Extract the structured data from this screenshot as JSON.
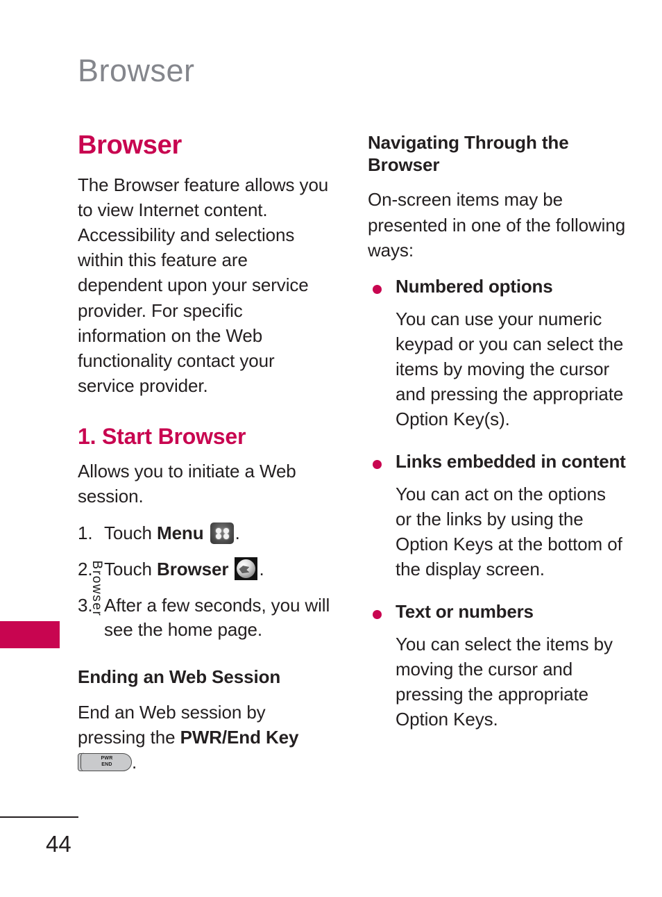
{
  "page": {
    "running_header": "Browser",
    "side_tab_label": "Browser",
    "page_number": "44",
    "accent_color": "#c80550",
    "header_color": "#84868c",
    "text_color": "#231f20"
  },
  "left_column": {
    "heading": "Browser",
    "intro": "The Browser feature allows you to view Internet content. Accessibility and selections within this feature are dependent upon your service provider. For specific information on the Web functionality contact your service provider.",
    "section_heading": "1. Start Browser",
    "section_intro": "Allows you to initiate a Web session.",
    "steps": [
      {
        "num": "1.",
        "pre": "Touch ",
        "bold": "Menu",
        "icon": "menu-grid-icon",
        "post": "."
      },
      {
        "num": "2.",
        "pre": "Touch ",
        "bold": "Browser",
        "icon": "globe-browser-icon",
        "post": "."
      },
      {
        "num": "3.",
        "pre": "After a few seconds, you will see the home page.",
        "bold": "",
        "icon": "",
        "post": ""
      }
    ],
    "subsection_heading": "Ending an Web Session",
    "ending_pre": "End an Web session by pressing the ",
    "ending_bold": "PWR/End Key",
    "ending_icon": "pwr-end-key-icon",
    "ending_icon_line1": "PWR",
    "ending_icon_line2": "END",
    "ending_post": "."
  },
  "right_column": {
    "heading": "Navigating Through the Browser",
    "intro": "On-screen items may be presented in one of the following ways:",
    "bullets": [
      {
        "title": "Numbered options",
        "body": "You can use your numeric keypad or you can select the items by moving the cursor and pressing the appropriate Option Key(s)."
      },
      {
        "title": "Links embedded in content",
        "body": "You can act on the options or the links by using the Option Keys at the bottom of the display screen."
      },
      {
        "title": "Text or numbers",
        "body": "You can select the items by moving the cursor and pressing the appropriate Option Keys."
      }
    ]
  }
}
